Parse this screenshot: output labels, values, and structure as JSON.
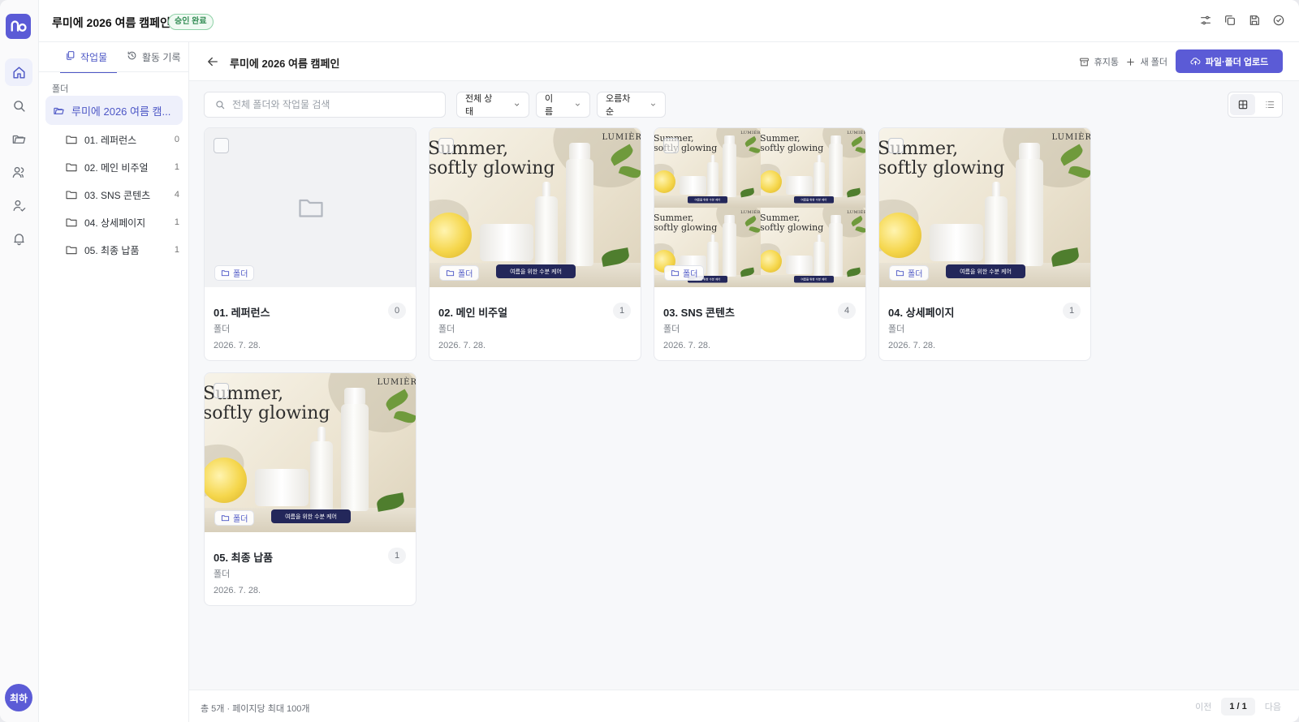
{
  "app": {
    "logo_text": "no",
    "title": "루미에 2026 여름 캠페인",
    "status_badge": "승인 완료",
    "user_initials": "최하"
  },
  "rail": {
    "items": [
      {
        "icon": "home-icon",
        "active": true
      },
      {
        "icon": "search-icon"
      },
      {
        "icon": "folder-icon"
      },
      {
        "icon": "users-icon"
      },
      {
        "icon": "user-check-icon"
      },
      {
        "icon": "bell-icon"
      }
    ]
  },
  "top_actions": [
    "sliders-icon",
    "copy-icon",
    "save-icon",
    "check-circle-icon"
  ],
  "sidebar": {
    "tabs": [
      {
        "label": "작업물",
        "active": true
      },
      {
        "label": "활동 기록",
        "active": false
      }
    ],
    "section_label": "폴더",
    "root": "루미에 2026 여름 캠...",
    "items": [
      {
        "label": "01. 레퍼런스",
        "count": "0"
      },
      {
        "label": "02. 메인 비주얼",
        "count": "1"
      },
      {
        "label": "03. SNS 콘텐츠",
        "count": "4"
      },
      {
        "label": "04. 상세페이지",
        "count": "1"
      },
      {
        "label": "05. 최종 납품",
        "count": "1"
      }
    ]
  },
  "main": {
    "title": "루미에 2026 여름 캠페인",
    "trash": "휴지통",
    "new_folder": "새 폴더",
    "upload": "파일·폴더 업로드",
    "search_placeholder": "전체 폴더와 작업물 검색",
    "filters": {
      "status": "전체 상태",
      "sort_by": "이름",
      "order": "오름차순"
    },
    "view_mode": "grid"
  },
  "ad_image": {
    "headline_1": "Summer,",
    "headline_2": "softly glowing",
    "brand": "LUMIÈR",
    "button_label": "여름을 위한 수분 케어"
  },
  "cards": [
    {
      "name": "01. 레퍼런스",
      "count": "0",
      "type": "폴더",
      "date": "2026. 7. 28.",
      "tag": "폴더",
      "preview": "empty"
    },
    {
      "name": "02. 메인 비주얼",
      "count": "1",
      "type": "폴더",
      "date": "2026. 7. 28.",
      "tag": "폴더",
      "preview": "single"
    },
    {
      "name": "03. SNS 콘텐츠",
      "count": "4",
      "type": "폴더",
      "date": "2026. 7. 28.",
      "tag": "폴더",
      "preview": "grid"
    },
    {
      "name": "04. 상세페이지",
      "count": "1",
      "type": "폴더",
      "date": "2026. 7. 28.",
      "tag": "폴더",
      "preview": "single"
    },
    {
      "name": "05. 최종 납품",
      "count": "1",
      "type": "폴더",
      "date": "2026. 7. 28.",
      "tag": "폴더",
      "preview": "single"
    }
  ],
  "footer": {
    "summary": "총 5개 · 페이지당 최대 100개",
    "prev": "이전",
    "page": "1 / 1",
    "next": "다음"
  },
  "colors": {
    "accent": "#5b5bd6",
    "badge_green": "#2f8a52"
  }
}
